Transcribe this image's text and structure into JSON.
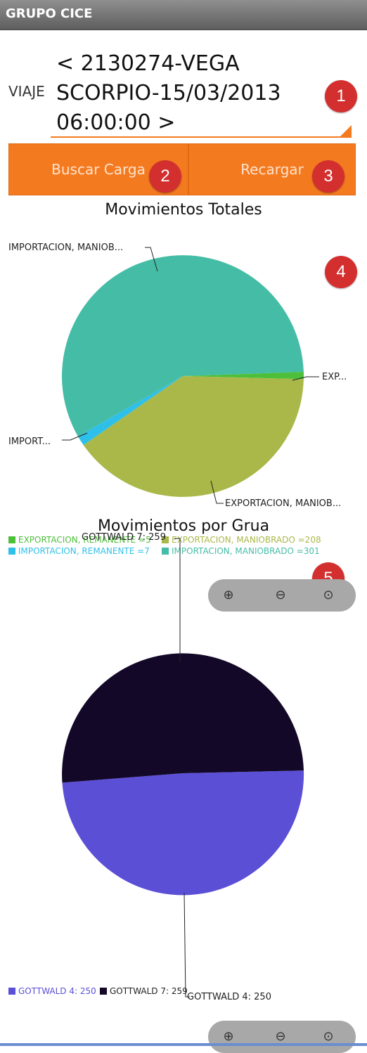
{
  "app": {
    "title": "GRUPO CICE"
  },
  "viaje": {
    "label": "VIAJE",
    "value": "< 2130274-VEGA\nSCORPIO-15/03/2013\n06:00:00 >"
  },
  "buttons": {
    "buscar": "Buscar Carga",
    "recargar": "Recargar"
  },
  "badges": [
    "1",
    "2",
    "3",
    "4",
    "5"
  ],
  "zoom_icons": [
    "zoom-in-icon",
    "zoom-out-icon",
    "zoom-reset-icon"
  ],
  "chart_data": [
    {
      "type": "pie",
      "title": "Movimientos Totales",
      "slices": [
        {
          "name": "EXPORTACION, REMANENTE",
          "value": 5,
          "color": "#4dbf3a",
          "slice_label": "EXP...",
          "legend": "EXPORTACION, REMANENTE =5"
        },
        {
          "name": "EXPORTACION, MANIOBRADO",
          "value": 208,
          "color": "#a9b848",
          "slice_label": "EXPORTACION, MANIOB...",
          "legend": "EXPORTACION, MANIOBRADO =208"
        },
        {
          "name": "IMPORTACION, REMANENTE",
          "value": 7,
          "color": "#2ec0e8",
          "slice_label": "IMPORT...",
          "legend": "IMPORTACION, REMANENTE =7"
        },
        {
          "name": "IMPORTACION, MANIOBRADO",
          "value": 301,
          "color": "#45bda6",
          "slice_label": "IMPORTACION, MANIOB...",
          "legend": "IMPORTACION, MANIOBRADO =301"
        }
      ]
    },
    {
      "type": "pie",
      "title": "Movimientos por Grua",
      "slices": [
        {
          "name": "GOTTWALD 4",
          "value": 250,
          "color": "#5b4fd6",
          "slice_label": "GOTTWALD 4: 250",
          "legend": "GOTTWALD 4: 250"
        },
        {
          "name": "GOTTWALD 7",
          "value": 259,
          "color": "#140828",
          "slice_label": "GOTTWALD 7: 259",
          "legend": "GOTTWALD 7: 259"
        }
      ]
    }
  ]
}
